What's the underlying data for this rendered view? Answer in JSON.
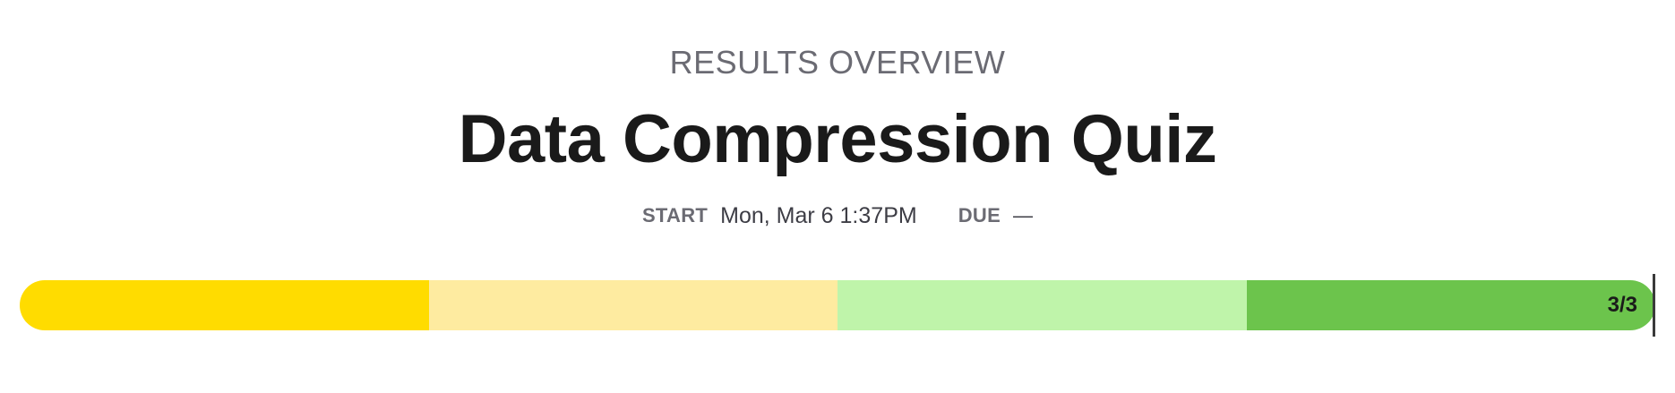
{
  "header": {
    "overline": "RESULTS OVERVIEW",
    "title": "Data Compression Quiz"
  },
  "meta": {
    "start_label": "START",
    "start_value": "Mon, Mar 6 1:37PM",
    "due_label": "DUE",
    "due_value": "—"
  },
  "progress": {
    "label": "3/3",
    "segments": [
      {
        "color": "#ffdc00"
      },
      {
        "color": "#feeba0"
      },
      {
        "color": "#bff4aa"
      },
      {
        "color": "#6cc44c"
      }
    ]
  }
}
